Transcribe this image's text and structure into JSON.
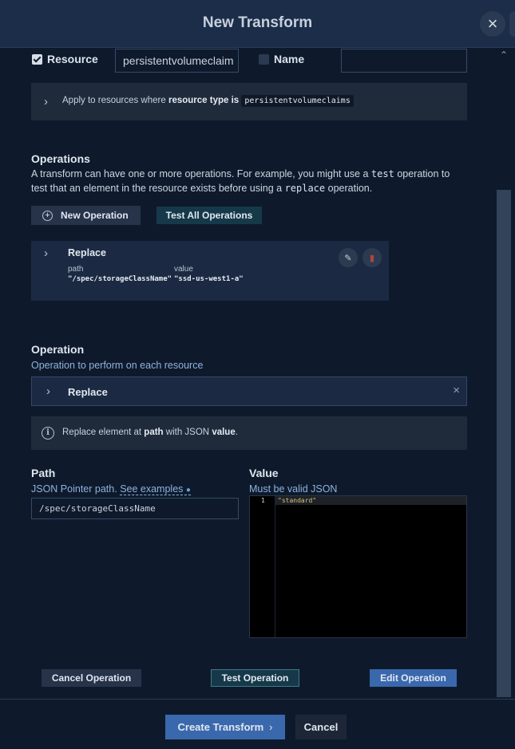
{
  "dialog": {
    "title": "New Transform"
  },
  "filters": {
    "resource": {
      "label": "Resource",
      "checked": true,
      "value": "persistentvolumeclaim"
    },
    "name": {
      "label": "Name",
      "checked": false,
      "value": ""
    }
  },
  "summary": {
    "prefix": "Apply to resources where",
    "bold": "resource type is",
    "chip": "persistentvolumeclaims"
  },
  "operations": {
    "title": "Operations",
    "desc_1": "A transform can have one or more operations. For example, you might use a",
    "desc_code_1": "test",
    "desc_2": "operation to test that an element in the resource exists before using a",
    "desc_code_2": "replace",
    "desc_3": "operation.",
    "new_label": "New Operation",
    "test_all_label": "Test All Operations",
    "card": {
      "title": "Replace",
      "path_header": "path",
      "value_header": "value",
      "path": "\"/spec/storageClassName\"",
      "value": "\"ssd-us-west1-a\""
    }
  },
  "operation": {
    "title": "Operation",
    "subtitle": "Operation to perform on each resource",
    "selected": "Replace",
    "info_prefix": "Replace element at",
    "info_bold_1": "path",
    "info_mid": "with JSON",
    "info_bold_2": "value",
    "info_end": "."
  },
  "path": {
    "title": "Path",
    "desc": "JSON Pointer path.",
    "link": "See examples",
    "value": "/spec/storageClassName"
  },
  "value": {
    "title": "Value",
    "desc": "Must be valid JSON",
    "line_number": "1",
    "code": "\"standard\""
  },
  "actions": {
    "cancel_op": "Cancel Operation",
    "test_op": "Test Operation",
    "edit_op": "Edit Operation",
    "create": "Create Transform",
    "cancel": "Cancel"
  },
  "colors": {
    "accent": "#3a68ad",
    "background": "#0e1a2c",
    "header": "#1b2d49",
    "teal": "#16394a"
  }
}
